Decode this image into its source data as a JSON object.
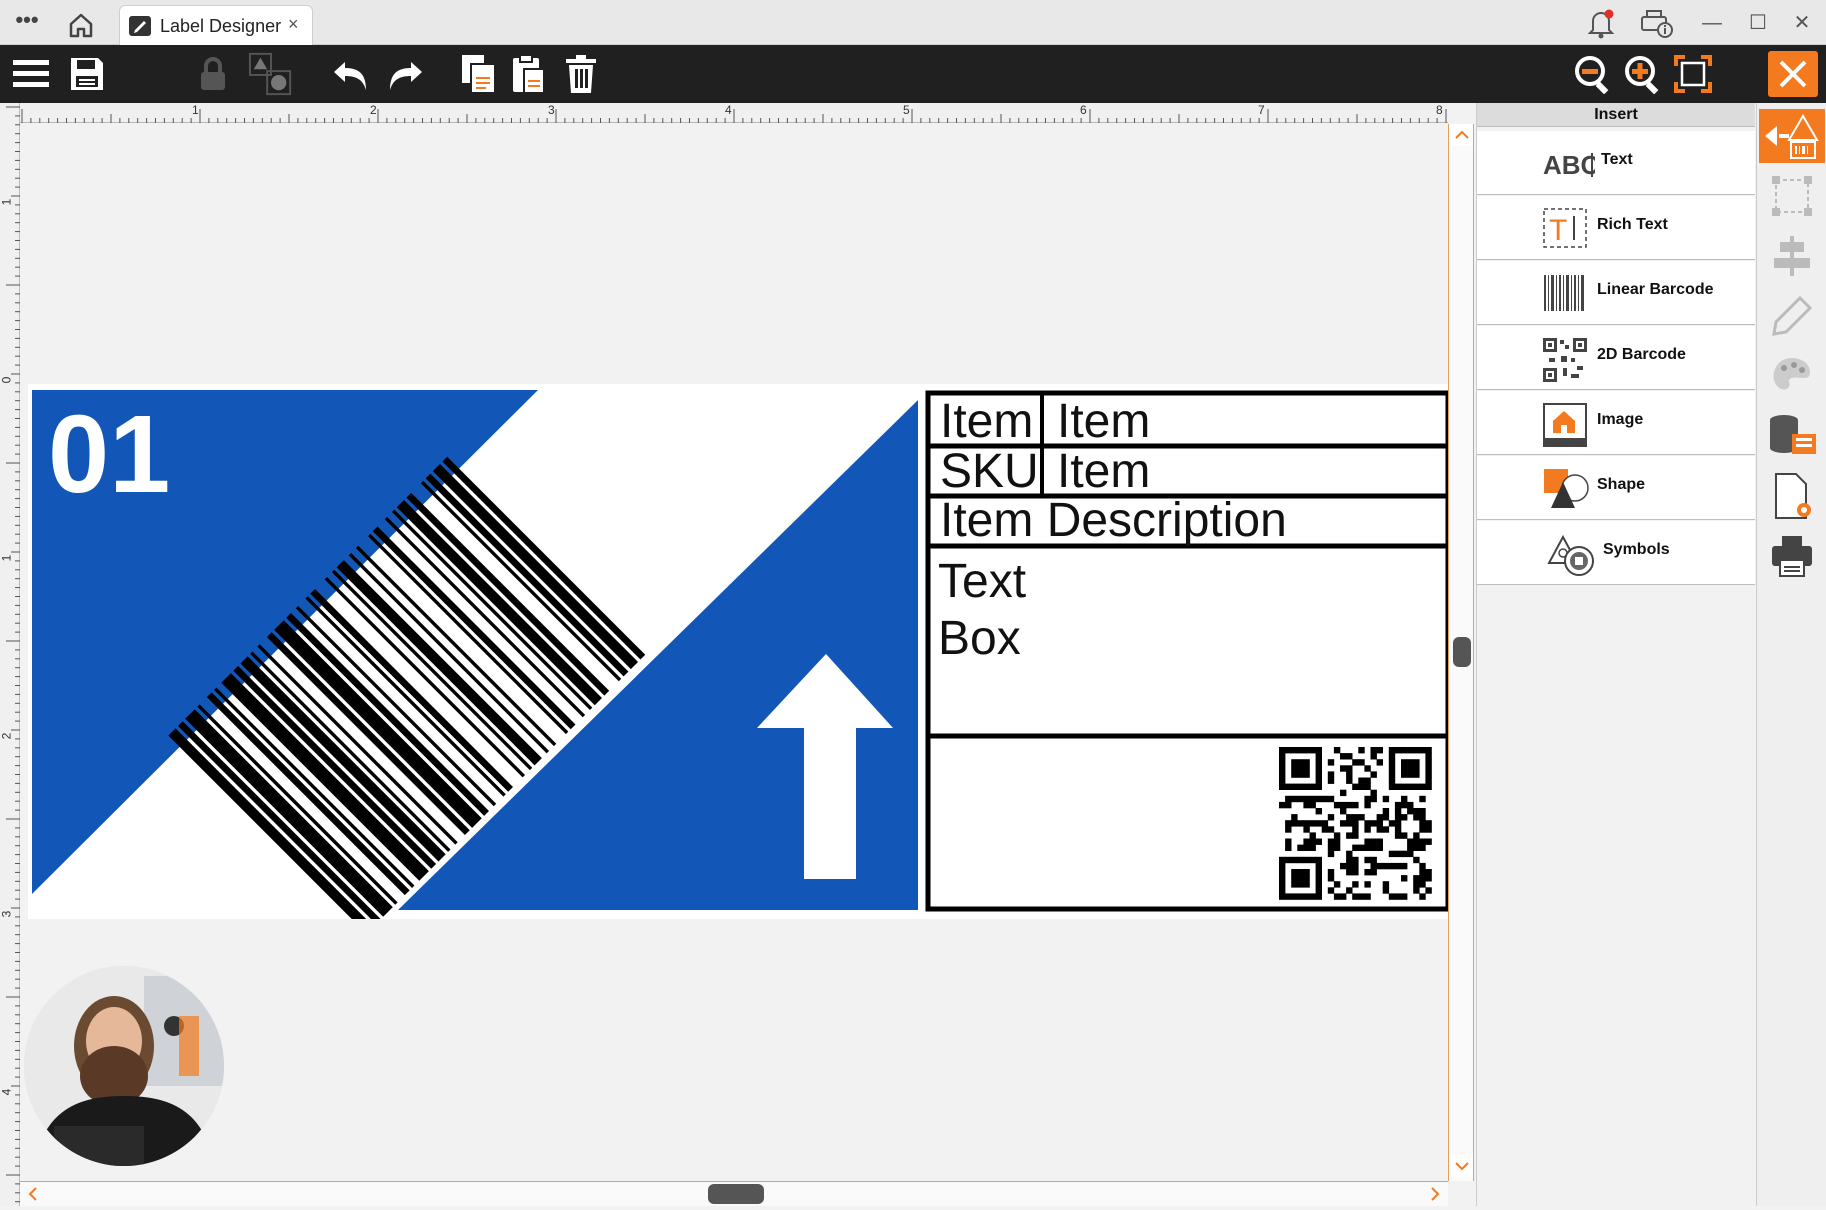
{
  "window": {
    "tab_title": "Label Designer",
    "tab_close": "×",
    "menu_dots": "•••",
    "minimize": "—",
    "maximize": "☐",
    "close": "✕"
  },
  "toolbar": {
    "icons": [
      "menu-icon",
      "save-icon",
      "lock-icon",
      "arrange-icon",
      "undo-icon",
      "redo-icon",
      "copy-icon",
      "paste-icon",
      "delete-icon",
      "zoom-out-icon",
      "zoom-in-icon",
      "fit-icon",
      "close-icon"
    ]
  },
  "ruler": {
    "top_labels": [
      "1",
      "2",
      "3",
      "4",
      "5",
      "6",
      "7",
      "8"
    ],
    "left_labels": [
      "1",
      "0",
      "1",
      "2",
      "3",
      "4"
    ]
  },
  "label": {
    "number": "01",
    "table": {
      "r1c1": "Item",
      "r1c2": "Item",
      "r2c1": "SKU",
      "r2c2": "Item",
      "r3": "Item Description",
      "text_box_line1": "Text",
      "text_box_line2": "Box"
    },
    "colors": {
      "blue": "#1257b8",
      "black": "#000000",
      "white": "#ffffff"
    }
  },
  "insert_panel": {
    "header": "Insert",
    "items": [
      {
        "label": "Text",
        "icon": "text-abc-icon"
      },
      {
        "label": "Rich Text",
        "icon": "rich-text-icon"
      },
      {
        "label": "Linear Barcode",
        "icon": "linear-barcode-icon"
      },
      {
        "label": "2D Barcode",
        "icon": "qr-code-icon"
      },
      {
        "label": "Image",
        "icon": "image-icon"
      },
      {
        "label": "Shape",
        "icon": "shape-icon"
      },
      {
        "label": "Symbols",
        "icon": "symbols-icon"
      }
    ]
  },
  "accent_color": "#f47a20"
}
